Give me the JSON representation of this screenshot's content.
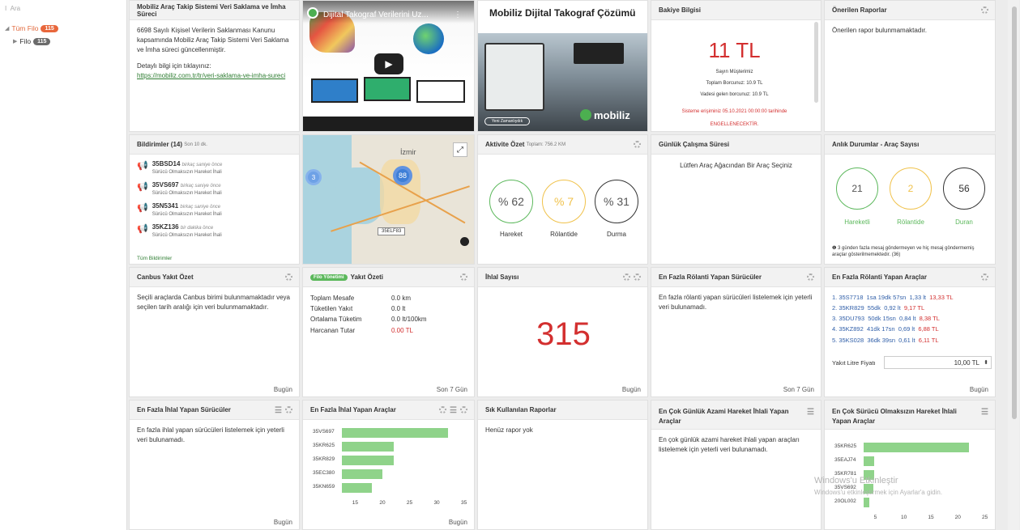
{
  "sidebar": {
    "search_placeholder": "Ara",
    "tree": [
      {
        "label": "Tüm Filo",
        "count": "115"
      },
      {
        "label": "Filo",
        "count": "115"
      }
    ]
  },
  "p1": {
    "title": "Mobiliz Araç Takip Sistemi Veri Saklama ve İmha Süreci",
    "text": "6698 Sayılı Kişisel Verilerin Saklanması Kanunu kapsamında Mobiliz Araç Takip Sistemi Veri Saklama ve İmha süreci güncellenmiştir.",
    "detail": "Detaylı bilgi için tıklayınız:",
    "link": "https://mobiliz.com.tr/tr/veri-saklama-ve-imha-sureci"
  },
  "video": {
    "title": "Dijital Takograf Verilerini Uz..."
  },
  "promo": {
    "title": "Mobiliz Dijital Takograf Çözümü",
    "brand": "mobiliz",
    "caption": "Yeni Zamanlıydık"
  },
  "balance": {
    "title": "Bakiye Bilgisi",
    "amount": "11 TL",
    "l1": "Sayın Müşterimiz",
    "l2": "Toplam Borcunuz: 10.9 TL",
    "l3": "Vadesi gelen borcunuz: 10.9 TL",
    "warn": "Sisteme erişiminiz 05.10.2021 00:00:00 tarihinde",
    "warn2": "ENGELLENECEKTİR."
  },
  "reports": {
    "title": "Önerilen Raporlar",
    "text": "Önerilen rapor bulunmamaktadır."
  },
  "notifications": {
    "title": "Bildirimler (14)",
    "sub": "Son 10 dk.",
    "items": [
      {
        "plate": "35BSD14",
        "ago": "birkaç saniye önce",
        "desc": "Sürücü Olmaksızın Hareket İhali"
      },
      {
        "plate": "35VS697",
        "ago": "birkaç saniye önce",
        "desc": "Sürücü Olmaksızın Hareket İhali"
      },
      {
        "plate": "35N5341",
        "ago": "birkaç saniye önce",
        "desc": "Sürücü Olmaksızın Hareket İhali"
      },
      {
        "plate": "35KZ136",
        "ago": "bir dakika önce",
        "desc": "Sürücü Olmaksızın Hareket İhali"
      }
    ],
    "all": "Tüm Bildirimler"
  },
  "map": {
    "city": "İzmir",
    "cluster1": "88",
    "cluster2": "3",
    "plate": "35ELF83"
  },
  "activity": {
    "title": "Aktivite Özet",
    "sub": "Toplam: 756.2 KM",
    "items": [
      {
        "val": "% 62",
        "label": "Hareket",
        "color": "#5cb85c"
      },
      {
        "val": "% 7",
        "label": "Rölantide",
        "color": "#f0c24b"
      },
      {
        "val": "% 31",
        "label": "Durma",
        "color": "#333333"
      }
    ]
  },
  "daily": {
    "title": "Günlük Çalışma Süresi",
    "text": "Lütfen Araç Ağacından Bir Araç Seçiniz"
  },
  "instant": {
    "title": "Anlık Durumlar - Araç Sayısı",
    "items": [
      {
        "val": "21",
        "label": "Hareketli",
        "color": "#5cb85c"
      },
      {
        "val": "2",
        "label": "Rölantide",
        "color": "#f0c24b"
      },
      {
        "val": "56",
        "label": "Duran",
        "color": "#333333"
      }
    ],
    "note": "3 günden fazla mesaj göndermeyen ve hiç mesaj göndermemiş araçlar gösterilmemektedir. (36)"
  },
  "canbus": {
    "title": "Canbus Yakıt Özet",
    "text": "Seçili araçlarda Canbus birimi bulunmamaktadır veya seçilen tarih aralığı için veri bulunmamaktadır.",
    "foot": "Bugün"
  },
  "fuel": {
    "tag": "Filo Yönetimi",
    "title": "Yakıt Özeti",
    "rows": [
      {
        "k": "Toplam Mesafe",
        "v": "0.0 km"
      },
      {
        "k": "Tüketilen Yakıt",
        "v": "0.0 lt"
      },
      {
        "k": "Ortalama Tüketim",
        "v": "0.0 lt/100km"
      },
      {
        "k": "Harcanan Tutar",
        "v": "0.00 TL"
      }
    ],
    "foot": "Son 7 Gün"
  },
  "ihlal": {
    "title": "İhlal Sayısı",
    "value": "315",
    "foot": "Bugün"
  },
  "idle_drivers": {
    "title": "En Fazla Rölanti Yapan Sürücüler",
    "text": "En fazla rölanti yapan sürücüleri listelemek için yeterli veri bulunamadı.",
    "foot": "Son 7 Gün"
  },
  "idle_vehicles": {
    "title": "En Fazla Rölanti Yapan Araçlar",
    "rows": [
      {
        "n": "1. 35S7718",
        "t": "1sa 19dk 57sn",
        "l": "1,33 lt",
        "c": "13,33 TL"
      },
      {
        "n": "2. 35KR829",
        "t": "55dk",
        "l": "0,92 lt",
        "c": "9,17 TL"
      },
      {
        "n": "3. 35DU793",
        "t": "50dk 15sn",
        "l": "0,84 lt",
        "c": "8,38 TL"
      },
      {
        "n": "4. 35KZ892",
        "t": "41dk 17sn",
        "l": "0,69 lt",
        "c": "6,88 TL"
      },
      {
        "n": "5. 35KS028",
        "t": "36dk 39sn",
        "l": "0,61 lt",
        "c": "6,11 TL"
      }
    ],
    "price_label": "Yakıt Litre Fiyatı",
    "price": "10,00 TL",
    "foot": "Bugün"
  },
  "viol_drivers": {
    "title": "En Fazla İhlal Yapan Sürücüler",
    "text": "En fazla ihlal yapan sürücüleri listelemek için yeterli veri bulunamadı.",
    "foot": "Bugün"
  },
  "viol_vehicles": {
    "title": "En Fazla İhlal Yapan Araçlar",
    "foot": "Bugün"
  },
  "frequent": {
    "title": "Sık Kullanılan Raporlar",
    "text": "Henüz rapor yok"
  },
  "daily_max": {
    "title": "En Çok Günlük Azami Hareket İhlali Yapan Araçlar",
    "text": "En çok günlük azami hareket ihlali yapan araçları listelemek için yeterli veri bulunamadı."
  },
  "nodriver": {
    "title": "En Çok Sürücü Olmaksızın Hareket İhlali Yapan Araçlar"
  },
  "watermark": {
    "line1": "Windows'u Etkinleştir",
    "line2": "Windows'u etkinleştirmek için Ayarlar'a gidin."
  },
  "chart_data": [
    {
      "type": "bar",
      "orientation": "horizontal",
      "categories": [
        "35VS697",
        "35KR625",
        "35KR829",
        "35EC380",
        "35KN659"
      ],
      "values": [
        32,
        22,
        22,
        20,
        18
      ],
      "xlim": [
        12.5,
        35
      ],
      "xticks": [
        "15",
        "20",
        "25",
        "30",
        "35"
      ]
    },
    {
      "type": "bar",
      "orientation": "horizontal",
      "categories": [
        "35KR625",
        "35EAJ74",
        "35KR781",
        "35VS692",
        "20OL002"
      ],
      "values": [
        22,
        4.5,
        4.5,
        4.3,
        3.5
      ],
      "xlim": [
        2.5,
        25
      ],
      "xticks": [
        "5",
        "10",
        "15",
        "20",
        "25"
      ]
    }
  ]
}
